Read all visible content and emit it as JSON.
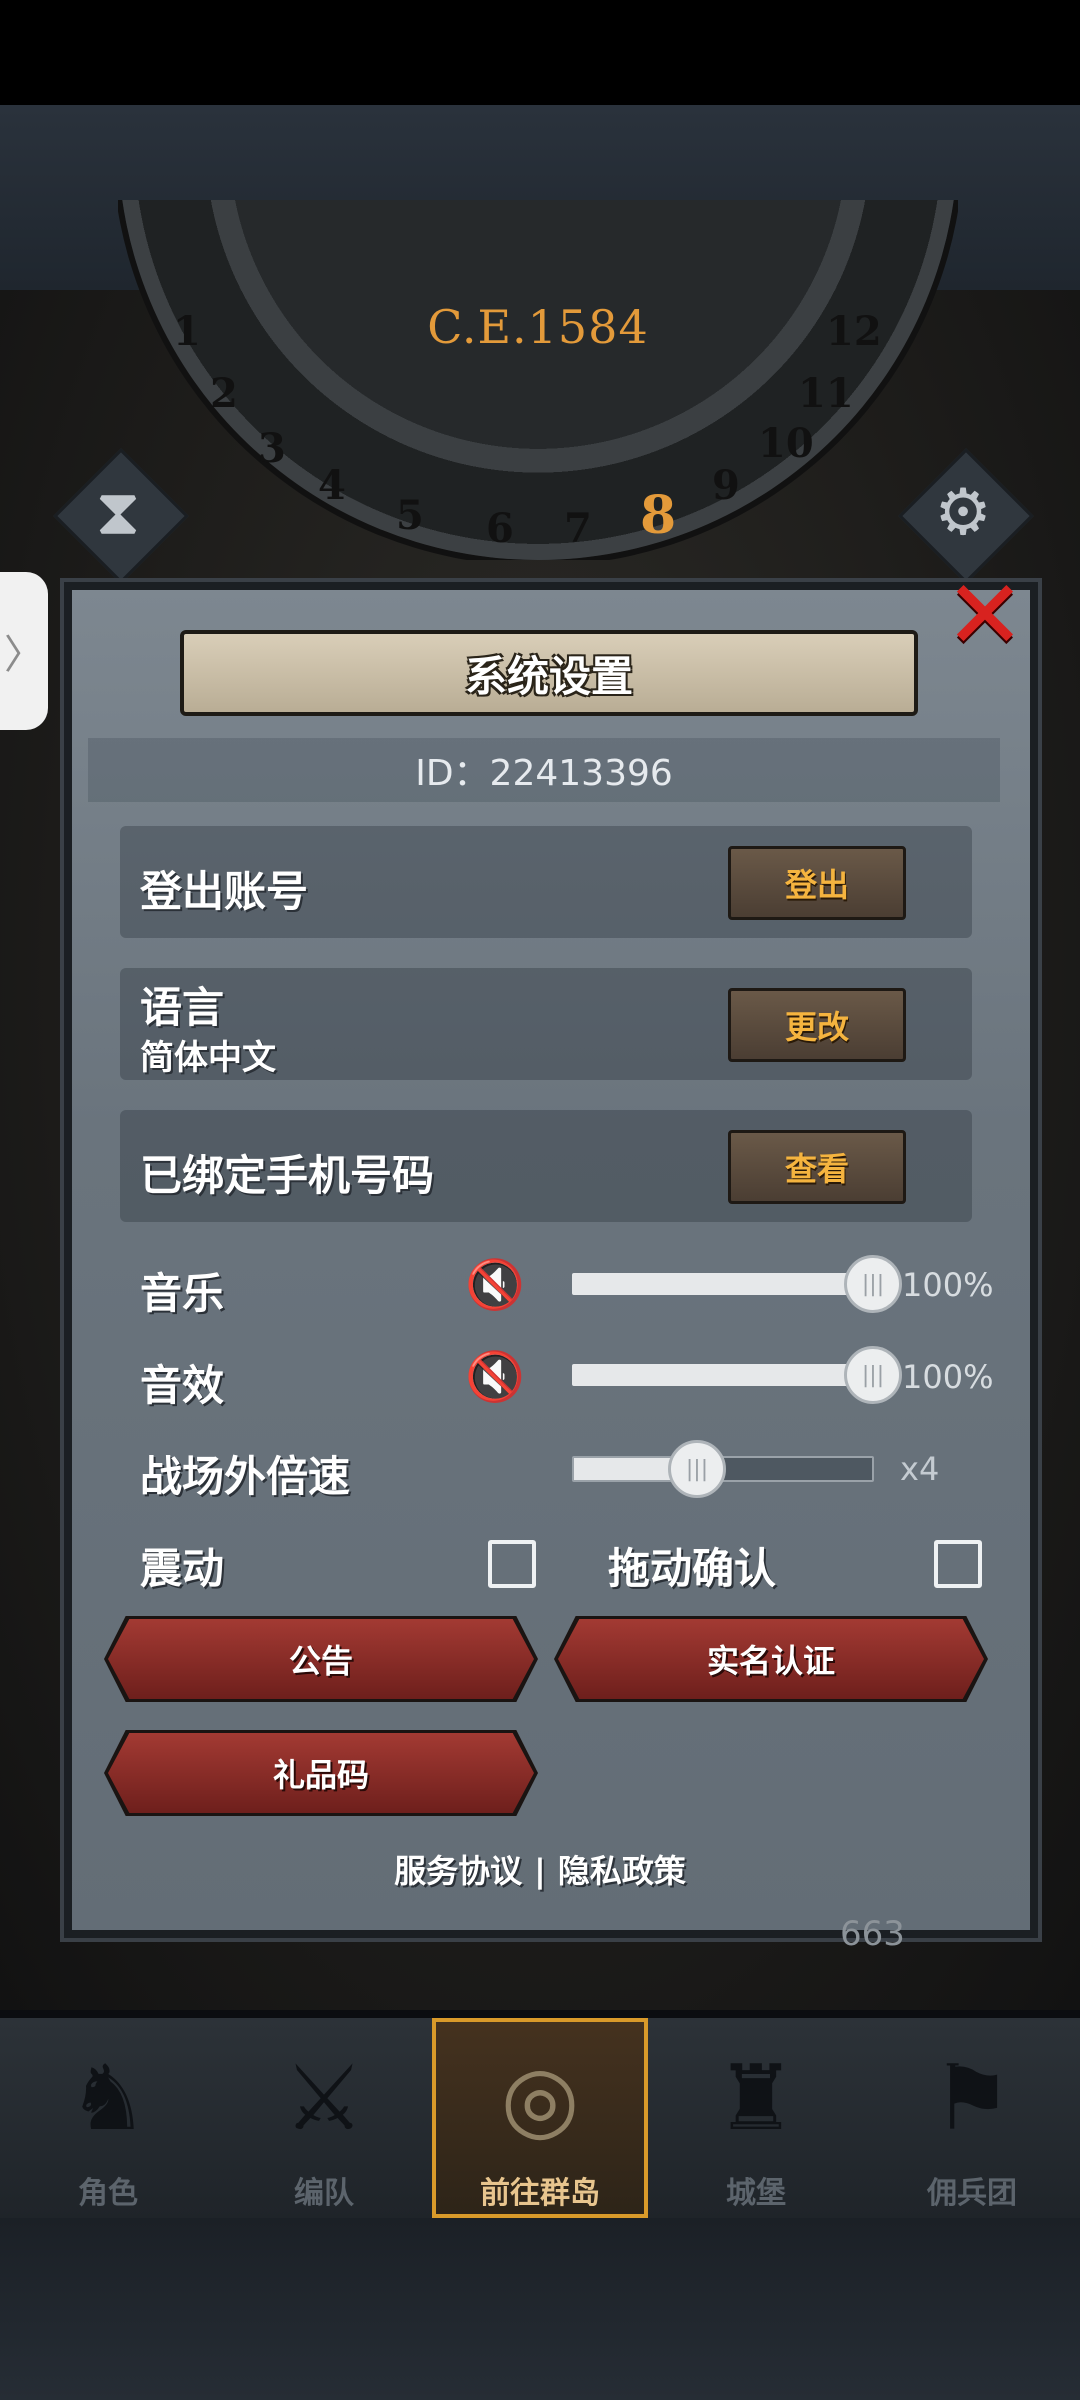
{
  "hud": {
    "year": "C.E.1584",
    "dial_numbers": [
      "1",
      "2",
      "3",
      "4",
      "5",
      "6",
      "7",
      "8",
      "9",
      "10",
      "11",
      "12"
    ],
    "current_month": "8"
  },
  "dialog": {
    "title": "系统设置",
    "id_text": "ID：22413396",
    "rows": [
      {
        "label": "登出账号",
        "button": "登出"
      },
      {
        "label": "语言",
        "sub": "简体中文",
        "button": "更改"
      },
      {
        "label": "已绑定手机号码",
        "button": "查看"
      }
    ],
    "music": {
      "label": "音乐",
      "value_text": "100%",
      "level": 1.0
    },
    "sfx": {
      "label": "音效",
      "value_text": "100%",
      "level": 1.0
    },
    "speed": {
      "label": "战场外倍速",
      "value_text": "x4",
      "level": 0.4
    },
    "vibration": {
      "label": "震动",
      "checked": false
    },
    "drag_confirm": {
      "label": "拖动确认",
      "checked": false
    },
    "buttons": {
      "announcement": "公告",
      "realname": "实名认证",
      "gift_code": "礼品码"
    },
    "links": {
      "tos": "服务协议",
      "separator": "|",
      "privacy": "隐私政策"
    }
  },
  "nav": {
    "items": [
      {
        "label": "角色",
        "icon": "knight-icon"
      },
      {
        "label": "编队",
        "icon": "warrior-icon"
      },
      {
        "label": "前往群岛",
        "icon": "globe-icon",
        "active": true
      },
      {
        "label": "城堡",
        "icon": "castle-icon"
      },
      {
        "label": "佣兵团",
        "icon": "banner-icon"
      }
    ]
  },
  "map_info": {
    "gems": "663"
  },
  "drawer_tab": "〉"
}
